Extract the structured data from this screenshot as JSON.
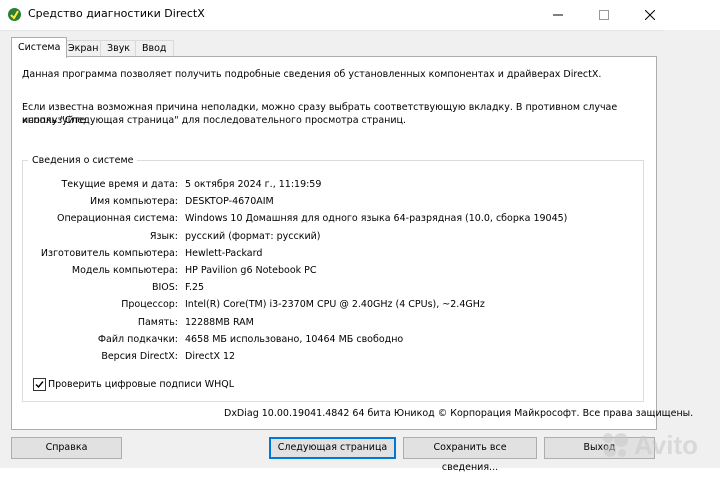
{
  "window": {
    "title": "Средство диагностики DirectX"
  },
  "tabs": [
    {
      "label": "Система",
      "active": true
    },
    {
      "label": "Экран",
      "active": false
    },
    {
      "label": "Звук",
      "active": false
    },
    {
      "label": "Ввод",
      "active": false
    }
  ],
  "intro": {
    "line1": "Данная программа позволяет получить подробные сведения об установленных компонентах и драйверах DirectX.",
    "line2a": "Если известна возможная причина неполадки, можно сразу выбрать соответствующую вкладку. В противном случае используйте",
    "line2b": "кнопку \"Следующая страница\" для последовательного просмотра страниц."
  },
  "system_info": {
    "group_title": "Сведения о системе",
    "rows": [
      {
        "label": "Текущие время и дата:",
        "value": "5 октября 2024 г., 11:19:59"
      },
      {
        "label": "Имя компьютера:",
        "value": "DESKTOP-4670AIM"
      },
      {
        "label": "Операционная система:",
        "value": "Windows 10 Домашняя для одного языка 64-разрядная (10.0, сборка 19045)"
      },
      {
        "label": "Язык:",
        "value": "русский (формат: русский)"
      },
      {
        "label": "Изготовитель компьютера:",
        "value": "Hewlett-Packard"
      },
      {
        "label": "Модель компьютера:",
        "value": "HP Pavilion g6 Notebook PC"
      },
      {
        "label": "BIOS:",
        "value": "F.25"
      },
      {
        "label": "Процессор:",
        "value": "Intel(R) Core(TM) i3-2370M CPU @ 2.40GHz (4 CPUs), ~2.4GHz"
      },
      {
        "label": "Память:",
        "value": "12288MB RAM"
      },
      {
        "label": "Файл подкачки:",
        "value": "4658 МБ использовано, 10464 МБ свободно"
      },
      {
        "label": "Версия DirectX:",
        "value": "DirectX 12"
      }
    ]
  },
  "whql": {
    "label": "Проверить цифровые подписи WHQL",
    "checked": true
  },
  "footer": "DxDiag 10.00.19041.4842 64 бита Юникод © Корпорация Майкрософт. Все права защищены.",
  "buttons": {
    "help": "Справка",
    "next": "Следующая страница",
    "save": "Сохранить все сведения...",
    "exit": "Выход"
  },
  "watermark": "Avito"
}
